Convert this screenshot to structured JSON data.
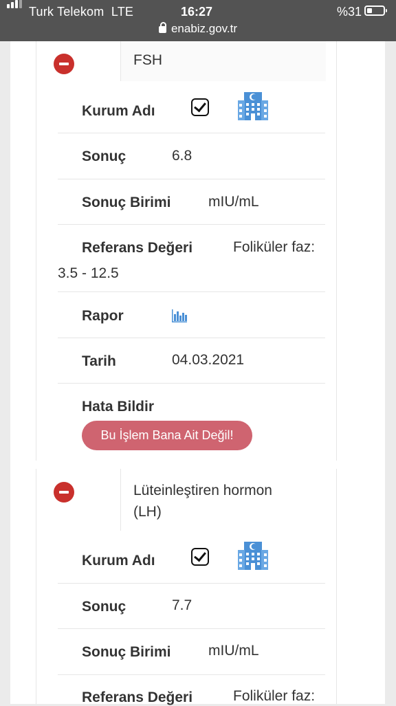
{
  "status_bar": {
    "carrier": "Turk Telekom",
    "network": "LTE",
    "time": "16:27",
    "battery": "%31",
    "url": "enabiz.gov.tr"
  },
  "results": [
    {
      "test_name": "FSH",
      "kurum_label": "Kurum Adı",
      "sonuc_label": "Sonuç",
      "sonuc_value": "6.8",
      "birim_label": "Sonuç Birimi",
      "birim_value": "mIU/mL",
      "referans_label": "Referans Değeri",
      "referans_value_1": "Foliküler faz:",
      "referans_value_2": "3.5 - 12.5",
      "rapor_label": "Rapor",
      "tarih_label": "Tarih",
      "tarih_value": "04.03.2021",
      "hata_label": "Hata Bildir",
      "hata_button": "Bu İşlem Bana Ait Değil!"
    },
    {
      "test_name_1": "Lüteinleştiren hormon",
      "test_name_2": "(LH)",
      "kurum_label": "Kurum Adı",
      "sonuc_label": "Sonuç",
      "sonuc_value": "7.7",
      "birim_label": "Sonuç Birimi",
      "birim_value": "mIU/mL",
      "referans_label": "Referans Değeri",
      "referans_value_1": "Foliküler faz:"
    }
  ],
  "colors": {
    "remove": "#c9302c",
    "error_button": "#cf6470",
    "icon_blue": "#4a90d6"
  },
  "icons": [
    "signal-icon",
    "lock-icon",
    "battery-icon",
    "remove-icon",
    "checkbox-checked-icon",
    "hospital-icon",
    "bar-chart-icon"
  ]
}
